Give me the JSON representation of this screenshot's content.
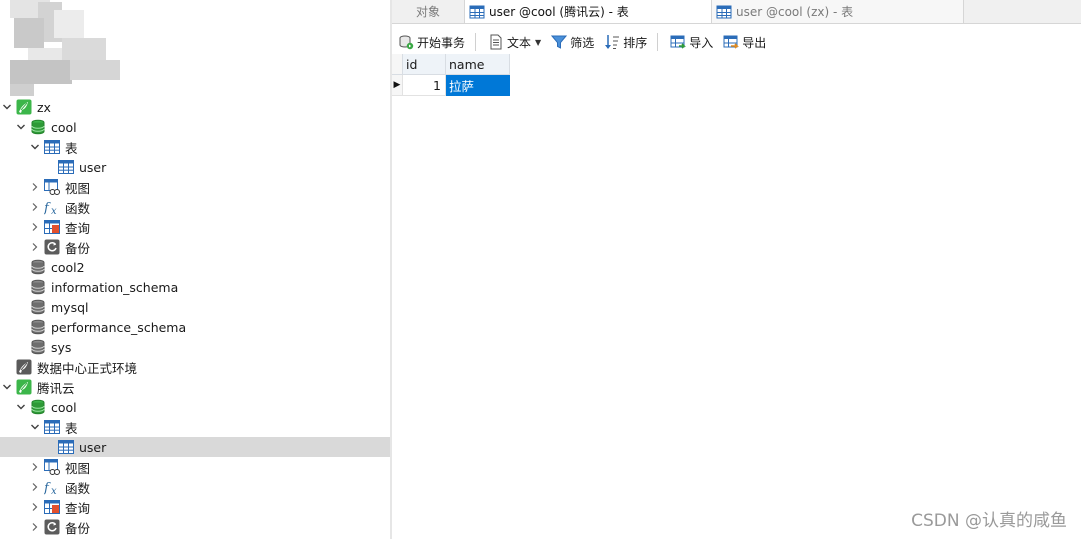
{
  "tree": {
    "rows": [
      {
        "label": "zx",
        "chevron": "down",
        "icon": "connection-icon",
        "level": 0
      },
      {
        "label": "cool",
        "chevron": "down",
        "icon": "database-open-icon",
        "level": 1
      },
      {
        "label": "表",
        "chevron": "down",
        "icon": "table-folder-icon",
        "level": 2
      },
      {
        "label": "user",
        "chevron": "none",
        "icon": "table-icon",
        "level": 3
      },
      {
        "label": "视图",
        "chevron": "right",
        "icon": "view-icon",
        "level": 2
      },
      {
        "label": "函数",
        "chevron": "right",
        "icon": "function-icon",
        "level": 2
      },
      {
        "label": "查询",
        "chevron": "right",
        "icon": "query-icon",
        "level": 2
      },
      {
        "label": "备份",
        "chevron": "right",
        "icon": "backup-icon",
        "level": 2
      },
      {
        "label": "cool2",
        "chevron": "none",
        "icon": "database-icon",
        "level": 1
      },
      {
        "label": "information_schema",
        "chevron": "none",
        "icon": "database-icon",
        "level": 1
      },
      {
        "label": "mysql",
        "chevron": "none",
        "icon": "database-icon",
        "level": 1
      },
      {
        "label": "performance_schema",
        "chevron": "none",
        "icon": "database-icon",
        "level": 1
      },
      {
        "label": "sys",
        "chevron": "none",
        "icon": "database-icon",
        "level": 1
      },
      {
        "label": "数据中心正式环境",
        "chevron": "none",
        "icon": "connection-closed-icon",
        "level": 0
      },
      {
        "label": "腾讯云",
        "chevron": "down",
        "icon": "connection-icon",
        "level": 0
      },
      {
        "label": "cool",
        "chevron": "down",
        "icon": "database-open-icon",
        "level": 1
      },
      {
        "label": "表",
        "chevron": "down",
        "icon": "table-folder-icon",
        "level": 2
      },
      {
        "label": "user",
        "chevron": "none",
        "icon": "table-icon",
        "level": 3,
        "selected": true
      },
      {
        "label": "视图",
        "chevron": "right",
        "icon": "view-icon",
        "level": 2
      },
      {
        "label": "函数",
        "chevron": "right",
        "icon": "function-icon",
        "level": 2
      },
      {
        "label": "查询",
        "chevron": "right",
        "icon": "query-icon",
        "level": 2
      },
      {
        "label": "备份",
        "chevron": "right",
        "icon": "backup-icon",
        "level": 2
      }
    ]
  },
  "tabs": [
    {
      "label": "对象",
      "icon": "none",
      "state": "inactive"
    },
    {
      "label": "user @cool (腾讯云) - 表",
      "icon": "table-icon",
      "state": "active"
    },
    {
      "label": "user @cool (zx) - 表",
      "icon": "table-icon",
      "state": "inactive"
    }
  ],
  "toolbar": {
    "begin_transaction": "开始事务",
    "text": "文本",
    "filter": "筛选",
    "sort": "排序",
    "import": "导入",
    "export": "导出"
  },
  "grid": {
    "columns": [
      "id",
      "name"
    ],
    "rows": [
      {
        "id": "1",
        "name": "拉萨"
      }
    ],
    "selected_cell_color": "#0078d7"
  },
  "watermark": "CSDN @认真的咸鱼",
  "colors": {
    "connection_green": "#3cb64a",
    "database_green": "#2e9a37",
    "table_blue": "#2b6cb8",
    "selection_gray": "#d9d9d9"
  }
}
